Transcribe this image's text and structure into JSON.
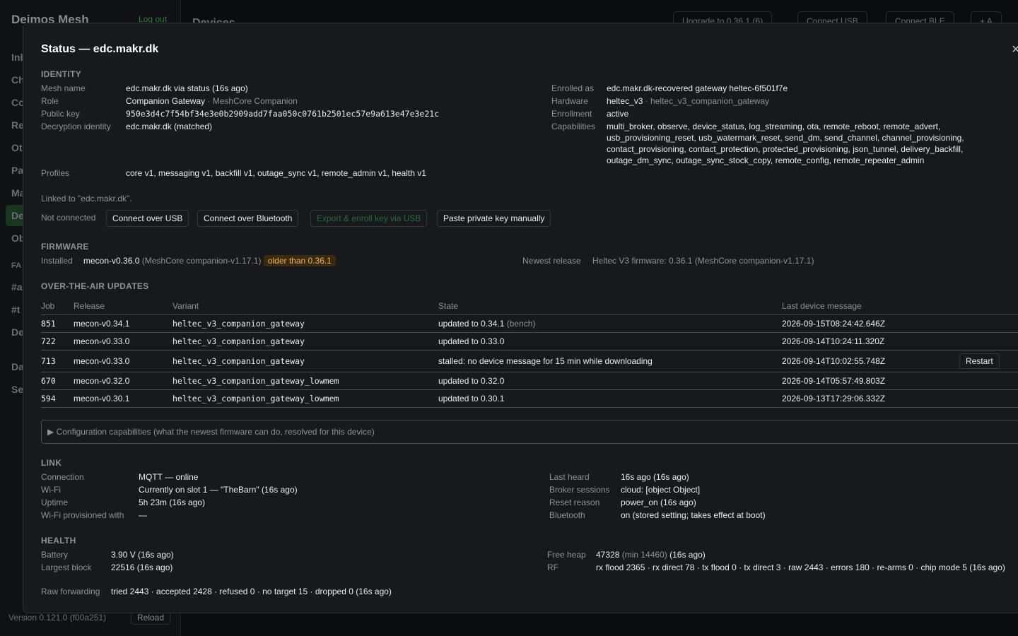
{
  "background": {
    "brand": "Deimos Mesh",
    "logout": "Log out",
    "nav": [
      "Inb",
      "Ch",
      "Co",
      "Re",
      "Ot",
      "Pa",
      "Ma",
      "De",
      "Ob",
      "FA",
      "#a",
      "#t",
      "De",
      "Da",
      "Se"
    ],
    "page_title": "Devices",
    "top_buttons": [
      "Upgrade to 0.36.1 (6)",
      "Connect USB",
      "Connect BLE",
      "+ A"
    ],
    "version": "Version 0.121.0 (f00a251)",
    "reload": "Reload"
  },
  "modal": {
    "title": "Status — edc.makr.dk",
    "close": "×"
  },
  "identity": {
    "heading": "IDENTITY",
    "mesh_name_label": "Mesh name",
    "mesh_name": "edc.makr.dk via status (16s ago)",
    "role_label": "Role",
    "role": "Companion Gateway",
    "role_sub": "· MeshCore Companion",
    "pubkey_label": "Public key",
    "pubkey": "950e3d4c7f54bf34e3e0b2909add7faa050c0761b2501ec57e9a613e47e3e21c",
    "decrypt_label": "Decryption identity",
    "decrypt": "edc.makr.dk (matched)",
    "enrolled_label": "Enrolled as",
    "enrolled": "edc.makr.dk-recovered gateway heltec-6f501f7e",
    "hardware_label": "Hardware",
    "hardware": "heltec_v3",
    "hardware_sub": "· heltec_v3_companion_gateway",
    "enrollment_label": "Enrollment",
    "enrollment": "active",
    "capabilities_label": "Capabilities",
    "capabilities": "multi_broker, observe, device_status, log_streaming, ota, remote_reboot, remote_advert, usb_provisioning_reset, usb_watermark_reset, send_dm, send_channel, channel_provisioning, contact_provisioning, contact_protection, protected_provisioning, json_tunnel, delivery_backfill, outage_dm_sync, outage_sync_stock_copy, remote_config, remote_repeater_admin",
    "profiles_label": "Profiles",
    "profiles": "core v1, messaging v1, backfill v1, outage_sync v1, remote_admin v1, health v1",
    "linked": "Linked to \"edc.makr.dk\".",
    "not_connected": "Not connected",
    "btn_usb": "Connect over USB",
    "btn_bt": "Connect over Bluetooth",
    "btn_export": "Export & enroll key via USB",
    "btn_paste": "Paste private key manually"
  },
  "firmware": {
    "heading": "FIRMWARE",
    "installed_label": "Installed",
    "installed": "mecon-v0.36.0",
    "installed_sub": "(MeshCore companion-v1.17.1)",
    "badge": "older than 0.36.1",
    "newest_label": "Newest release",
    "newest": "Heltec V3 firmware: 0.36.1 (MeshCore companion-v1.17.1)"
  },
  "ota": {
    "heading": "OVER-THE-AIR UPDATES",
    "columns": [
      "Job",
      "Release",
      "Variant",
      "State",
      "Last device message"
    ],
    "rows": [
      {
        "job": "851",
        "release": "mecon-v0.34.1",
        "variant": "heltec_v3_companion_gateway",
        "state": "updated to 0.34.1",
        "state_sub": "(bench)",
        "ts": "2026-09-15T08:24:42.646Z",
        "action": ""
      },
      {
        "job": "722",
        "release": "mecon-v0.33.0",
        "variant": "heltec_v3_companion_gateway",
        "state": "updated to 0.33.0",
        "state_sub": "",
        "ts": "2026-09-14T10:24:11.320Z",
        "action": ""
      },
      {
        "job": "713",
        "release": "mecon-v0.33.0",
        "variant": "heltec_v3_companion_gateway",
        "state": "stalled: no device message for 15 min while downloading",
        "state_sub": "",
        "ts": "2026-09-14T10:02:55.748Z",
        "action": "Restart"
      },
      {
        "job": "670",
        "release": "mecon-v0.32.0",
        "variant": "heltec_v3_companion_gateway_lowmem",
        "state": "updated to 0.32.0",
        "state_sub": "",
        "ts": "2026-09-14T05:57:49.803Z",
        "action": ""
      },
      {
        "job": "594",
        "release": "mecon-v0.30.1",
        "variant": "heltec_v3_companion_gateway_lowmem",
        "state": "updated to 0.30.1",
        "state_sub": "",
        "ts": "2026-09-13T17:29:06.332Z",
        "action": ""
      }
    ]
  },
  "config_caps": "▶ Configuration capabilities (what the newest firmware can do, resolved for this device)",
  "link": {
    "heading": "LINK",
    "connection_label": "Connection",
    "connection": "MQTT — online",
    "wifi_label": "Wi-Fi",
    "wifi": "Currently on slot 1 — \"TheBarn\" (16s ago)",
    "uptime_label": "Uptime",
    "uptime": "5h 23m (16s ago)",
    "wifi_prov_label": "Wi-Fi provisioned with",
    "wifi_prov": "—",
    "last_heard_label": "Last heard",
    "last_heard": "16s ago (16s ago)",
    "broker_label": "Broker sessions",
    "broker": "cloud: [object Object]",
    "reset_label": "Reset reason",
    "reset": "power_on (16s ago)",
    "bt_label": "Bluetooth",
    "bt": "on (stored setting; takes effect at boot)"
  },
  "health": {
    "heading": "HEALTH",
    "battery_label": "Battery",
    "battery": "3.90 V (16s ago)",
    "largest_label": "Largest block",
    "largest": "22516 (16s ago)",
    "heap_label": "Free heap",
    "heap": "47328",
    "heap_min": "(min 14460)",
    "heap_ago": "(16s ago)",
    "rf_label": "RF",
    "rf": "rx flood 2365 · rx direct 78 · tx flood 0 · tx direct 3 · raw 2443 · errors 180 · re-arms 0 · chip mode 5 (16s ago)",
    "raw_label": "Raw forwarding",
    "raw": "tried 2443 · accepted 2428 · refused 0 · no target 15 · dropped 0 (16s ago)"
  }
}
